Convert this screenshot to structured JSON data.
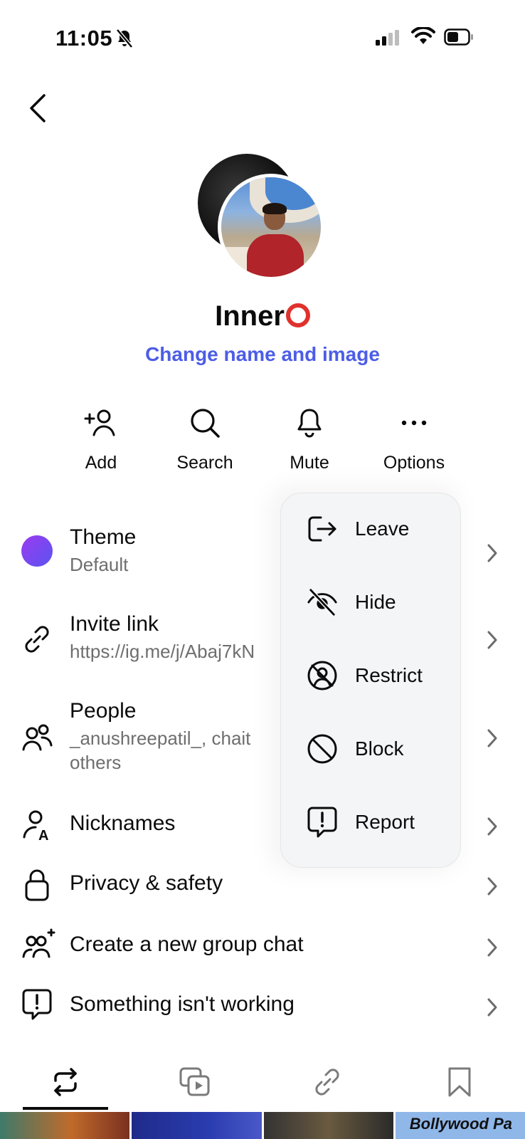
{
  "status_bar": {
    "time": "11:05"
  },
  "header": {
    "back_label": "Back"
  },
  "chat": {
    "name": "Inner",
    "change_name_link": "Change name and image"
  },
  "actions": [
    {
      "label": "Add",
      "icon": "add-person-icon"
    },
    {
      "label": "Search",
      "icon": "search-icon"
    },
    {
      "label": "Mute",
      "icon": "bell-icon"
    },
    {
      "label": "Options",
      "icon": "more-horizontal-icon"
    }
  ],
  "settings": {
    "theme": {
      "title": "Theme",
      "value": "Default"
    },
    "invite_link": {
      "title": "Invite link",
      "value": "https://ig.me/j/Abaj7kN"
    },
    "people": {
      "title": "People",
      "line1": "_anushreepatil_, chait",
      "line2": "others"
    },
    "nicknames": {
      "title": "Nicknames"
    },
    "privacy": {
      "title": "Privacy & safety"
    },
    "new_group": {
      "title": "Create a new group chat"
    },
    "report_problem": {
      "title": "Something isn't working"
    }
  },
  "options_menu": [
    {
      "label": "Leave",
      "icon": "leave-icon"
    },
    {
      "label": "Hide",
      "icon": "eye-off-icon"
    },
    {
      "label": "Restrict",
      "icon": "restrict-icon"
    },
    {
      "label": "Block",
      "icon": "block-icon"
    },
    {
      "label": "Report",
      "icon": "report-icon"
    }
  ],
  "tabs": [
    {
      "icon": "repost-icon",
      "active": true
    },
    {
      "icon": "media-icon"
    },
    {
      "icon": "link-icon"
    },
    {
      "icon": "bookmark-icon"
    }
  ],
  "media_strip": {
    "thumb4_text": "Bollywood Pa"
  },
  "colors": {
    "link": "#4c5de6",
    "accent_ring": "#e0312c",
    "theme_gradient": [
      "#9b3bf0",
      "#5a54f0"
    ]
  }
}
